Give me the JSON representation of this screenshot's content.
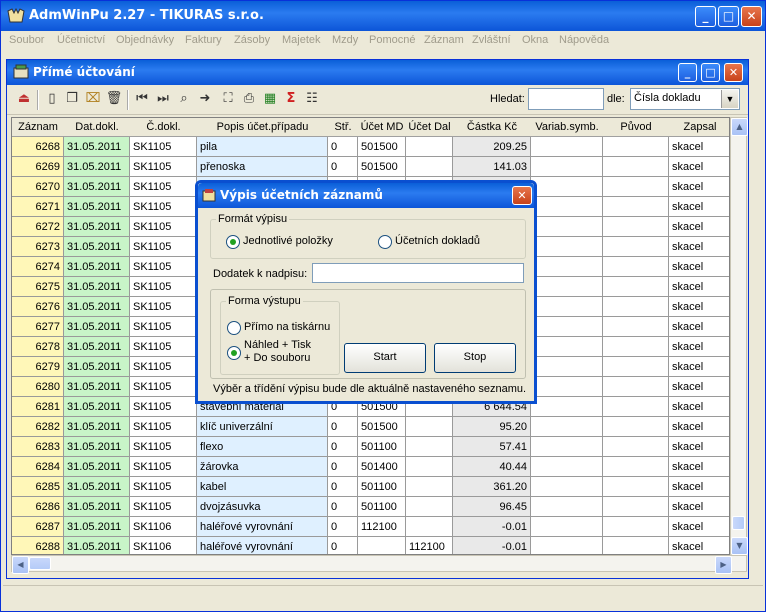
{
  "app": {
    "title": "AdmWinPu 2.27 - TIKURAS  s.r.o.",
    "window_buttons": [
      "_",
      "□",
      "✕"
    ]
  },
  "menu": [
    "Soubor",
    "Účetnictví",
    "Objednávky",
    "Faktury",
    "Zásoby",
    "Majetek",
    "Mzdy",
    "Pomocné",
    "Záznam",
    "Zvláštní",
    "Okna",
    "Nápověda"
  ],
  "child": {
    "title": "Přímé účtování",
    "search_label": "Hledat:",
    "search_value": "",
    "by_label": "dle:",
    "by_value": "Čísla dokladu"
  },
  "columns": [
    "Záznam",
    "Dat.dokl.",
    "Č.dokl.",
    "Popis účet.případu",
    "Stř.",
    "Účet MD",
    "Účet Dal",
    "Částka Kč",
    "Variab.symb.",
    "Původ",
    "Zapsal"
  ],
  "rows": [
    {
      "zaznam": "6268",
      "dat": "31.05.2011",
      "cdokl": "SK1105",
      "popis": "pila",
      "str": "0",
      "md": "501500",
      "dal": "",
      "castka": "209.25",
      "vs": "",
      "puvod": "",
      "zapsal": "skacel"
    },
    {
      "zaznam": "6269",
      "dat": "31.05.2011",
      "cdokl": "SK1105",
      "popis": "přenoska",
      "str": "0",
      "md": "501500",
      "dal": "",
      "castka": "141.03",
      "vs": "",
      "puvod": "",
      "zapsal": "skacel"
    },
    {
      "zaznam": "6270",
      "dat": "31.05.2011",
      "cdokl": "SK1105",
      "popis": "",
      "str": "",
      "md": "",
      "dal": "",
      "castka": "",
      "vs": "",
      "puvod": "",
      "zapsal": "skacel"
    },
    {
      "zaznam": "6271",
      "dat": "31.05.2011",
      "cdokl": "SK1105",
      "popis": "",
      "str": "",
      "md": "",
      "dal": "",
      "castka": "",
      "vs": "",
      "puvod": "",
      "zapsal": "skacel"
    },
    {
      "zaznam": "6272",
      "dat": "31.05.2011",
      "cdokl": "SK1105",
      "popis": "",
      "str": "",
      "md": "",
      "dal": "",
      "castka": "",
      "vs": "",
      "puvod": "",
      "zapsal": "skacel"
    },
    {
      "zaznam": "6273",
      "dat": "31.05.2011",
      "cdokl": "SK1105",
      "popis": "",
      "str": "",
      "md": "",
      "dal": "",
      "castka": "",
      "vs": "",
      "puvod": "",
      "zapsal": "skacel"
    },
    {
      "zaznam": "6274",
      "dat": "31.05.2011",
      "cdokl": "SK1105",
      "popis": "",
      "str": "",
      "md": "",
      "dal": "",
      "castka": "",
      "vs": "",
      "puvod": "",
      "zapsal": "skacel"
    },
    {
      "zaznam": "6275",
      "dat": "31.05.2011",
      "cdokl": "SK1105",
      "popis": "",
      "str": "",
      "md": "",
      "dal": "",
      "castka": "",
      "vs": "",
      "puvod": "",
      "zapsal": "skacel"
    },
    {
      "zaznam": "6276",
      "dat": "31.05.2011",
      "cdokl": "SK1105",
      "popis": "",
      "str": "",
      "md": "",
      "dal": "",
      "castka": "",
      "vs": "",
      "puvod": "",
      "zapsal": "skacel"
    },
    {
      "zaznam": "6277",
      "dat": "31.05.2011",
      "cdokl": "SK1105",
      "popis": "",
      "str": "",
      "md": "",
      "dal": "",
      "castka": "",
      "vs": "",
      "puvod": "",
      "zapsal": "skacel"
    },
    {
      "zaznam": "6278",
      "dat": "31.05.2011",
      "cdokl": "SK1105",
      "popis": "",
      "str": "",
      "md": "",
      "dal": "",
      "castka": "",
      "vs": "",
      "puvod": "",
      "zapsal": "skacel"
    },
    {
      "zaznam": "6279",
      "dat": "31.05.2011",
      "cdokl": "SK1105",
      "popis": "",
      "str": "",
      "md": "",
      "dal": "",
      "castka": "",
      "vs": "",
      "puvod": "",
      "zapsal": "skacel"
    },
    {
      "zaznam": "6280",
      "dat": "31.05.2011",
      "cdokl": "SK1105",
      "popis": "",
      "str": "",
      "md": "",
      "dal": "",
      "castka": "",
      "vs": "",
      "puvod": "",
      "zapsal": "skacel"
    },
    {
      "zaznam": "6281",
      "dat": "31.05.2011",
      "cdokl": "SK1105",
      "popis": "stavební materiál",
      "str": "0",
      "md": "501500",
      "dal": "",
      "castka": "6 644.54",
      "vs": "",
      "puvod": "",
      "zapsal": "skacel"
    },
    {
      "zaznam": "6282",
      "dat": "31.05.2011",
      "cdokl": "SK1105",
      "popis": "klíč univerzální",
      "str": "0",
      "md": "501500",
      "dal": "",
      "castka": "95.20",
      "vs": "",
      "puvod": "",
      "zapsal": "skacel"
    },
    {
      "zaznam": "6283",
      "dat": "31.05.2011",
      "cdokl": "SK1105",
      "popis": "flexo",
      "str": "0",
      "md": "501100",
      "dal": "",
      "castka": "57.41",
      "vs": "",
      "puvod": "",
      "zapsal": "skacel"
    },
    {
      "zaznam": "6284",
      "dat": "31.05.2011",
      "cdokl": "SK1105",
      "popis": "žárovka",
      "str": "0",
      "md": "501400",
      "dal": "",
      "castka": "40.44",
      "vs": "",
      "puvod": "",
      "zapsal": "skacel"
    },
    {
      "zaznam": "6285",
      "dat": "31.05.2011",
      "cdokl": "SK1105",
      "popis": "kabel",
      "str": "0",
      "md": "501100",
      "dal": "",
      "castka": "361.20",
      "vs": "",
      "puvod": "",
      "zapsal": "skacel"
    },
    {
      "zaznam": "6286",
      "dat": "31.05.2011",
      "cdokl": "SK1105",
      "popis": "dvojzásuvka",
      "str": "0",
      "md": "501100",
      "dal": "",
      "castka": "96.45",
      "vs": "",
      "puvod": "",
      "zapsal": "skacel"
    },
    {
      "zaznam": "6287",
      "dat": "31.05.2011",
      "cdokl": "SK1106",
      "popis": "haléřové vyrovnání",
      "str": "0",
      "md": "112100",
      "dal": "",
      "castka": "-0.01",
      "vs": "",
      "puvod": "",
      "zapsal": "skacel"
    },
    {
      "zaznam": "6288",
      "dat": "31.05.2011",
      "cdokl": "SK1106",
      "popis": "haléřové vyrovnání",
      "str": "0",
      "md": "",
      "dal": "112100",
      "castka": "-0.01",
      "vs": "",
      "puvod": "",
      "zapsal": "skacel"
    }
  ],
  "dialog": {
    "title": "Výpis účetních záznamů",
    "format_group": "Formát výpisu",
    "opt_items": "Jednotlivé položky",
    "opt_docs": "Účetních dokladů",
    "addendum_label": "Dodatek k nadpisu:",
    "addendum_value": "",
    "output_group": "Forma výstupu",
    "opt_printer": "Přímo na tiskárnu",
    "opt_preview_l1": "Náhled + Tisk",
    "opt_preview_l2": "+ Do souboru",
    "start": "Start",
    "stop": "Stop",
    "note": "Výběr a třídění výpisu bude dle aktuálně nastaveného seznamu."
  }
}
